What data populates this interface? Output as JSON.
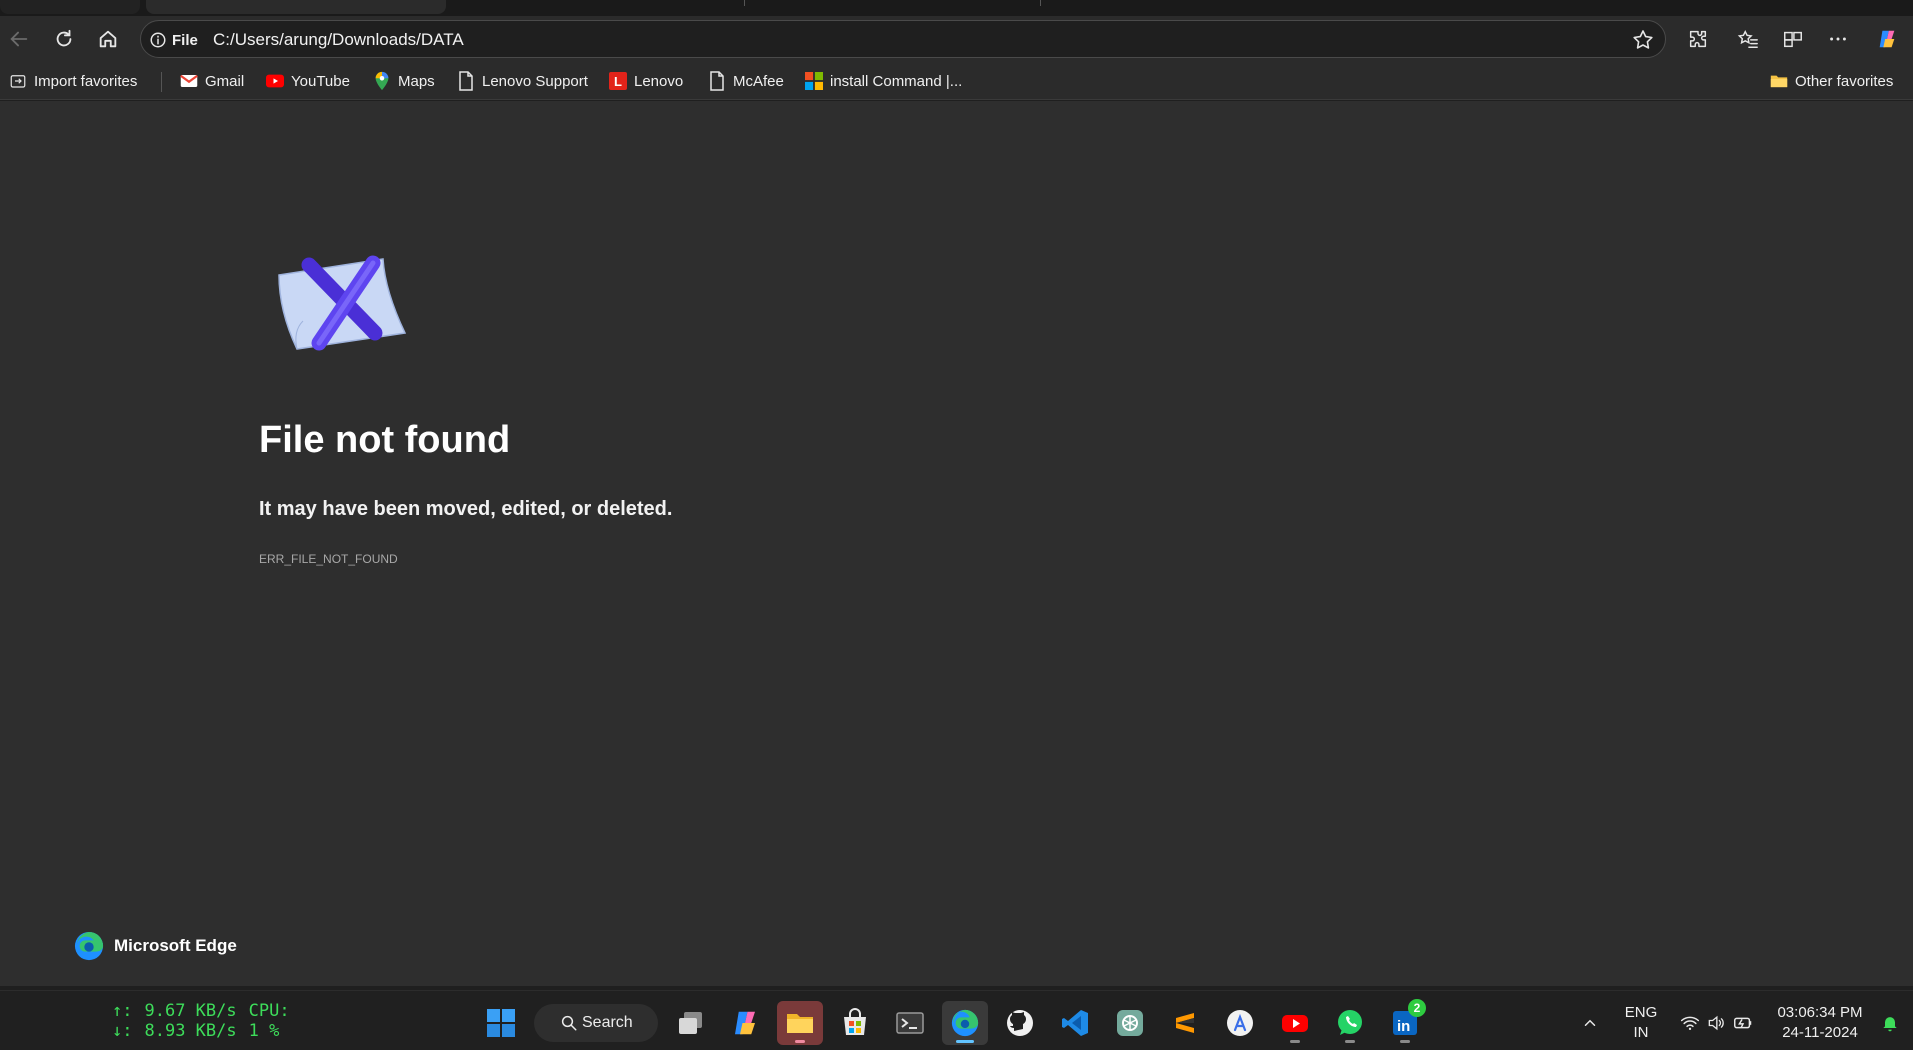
{
  "browser": {
    "address": {
      "scheme_label": "File",
      "url": "C:/Users/arung/Downloads/DATA"
    },
    "bookmarks": [
      {
        "label": "Import favorites",
        "icon": "import-icon"
      },
      {
        "label": "Gmail",
        "icon": "gmail-icon"
      },
      {
        "label": "YouTube",
        "icon": "youtube-icon"
      },
      {
        "label": "Maps",
        "icon": "maps-icon"
      },
      {
        "label": "Lenovo Support",
        "icon": "page-icon"
      },
      {
        "label": "Lenovo",
        "icon": "lenovo-icon"
      },
      {
        "label": "McAfee",
        "icon": "page-icon"
      },
      {
        "label": "install Command |...",
        "icon": "windows-icon"
      }
    ],
    "other_favorites": "Other favorites"
  },
  "error_page": {
    "title": "File not found",
    "subtitle": "It may have been moved, edited, or deleted.",
    "code": "ERR_FILE_NOT_FOUND",
    "footer_brand": "Microsoft Edge"
  },
  "taskbar": {
    "net_up_arrow": "↑:",
    "net_up": "9.67 KB/s",
    "net_down_arrow": "↓:",
    "net_down": "8.93 KB/s",
    "cpu_label": "CPU:",
    "cpu_value": "1 %",
    "search_label": "Search",
    "linkedin_badge": "2",
    "lang_line1": "ENG",
    "lang_line2": "IN",
    "time": "03:06:34 PM",
    "date": "24-11-2024"
  },
  "colors": {
    "accent_green": "#3ddc5a",
    "edge_blue": "#1e90ff",
    "page_background": "#2e2e2e"
  }
}
